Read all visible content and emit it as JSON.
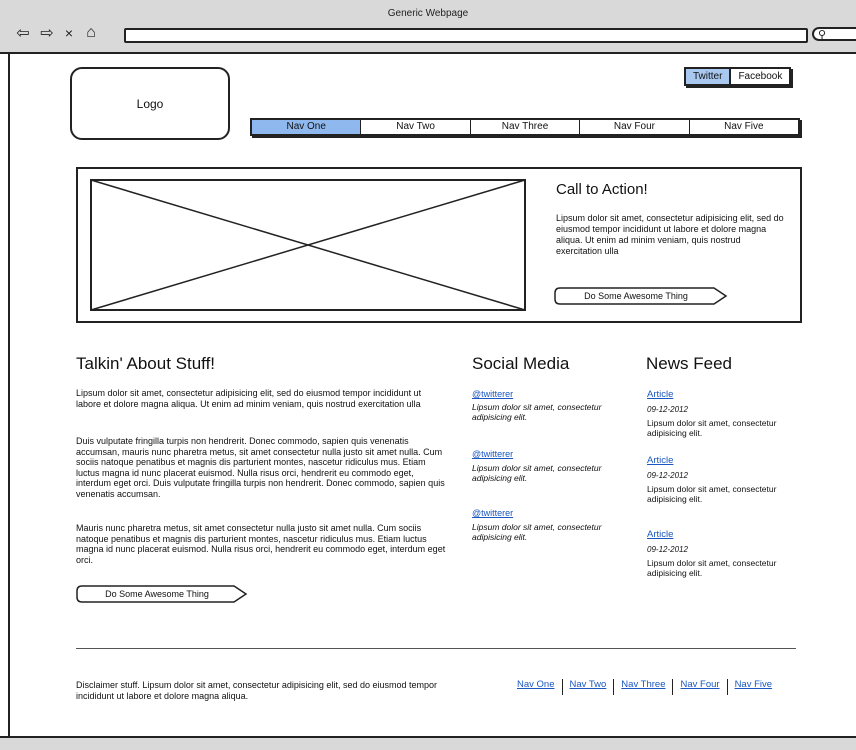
{
  "window": {
    "title": "Generic Webpage"
  },
  "header": {
    "logo_label": "Logo",
    "social_tabs": [
      "Twitter",
      "Facebook"
    ],
    "nav": [
      "Nav One",
      "Nav Two",
      "Nav Three",
      "Nav Four",
      "Nav Five"
    ]
  },
  "hero": {
    "title": "Call to Action!",
    "body": "Lipsum dolor sit amet, consectetur adipisicing elit, sed do eiusmod tempor incididunt ut labore et dolore magna aliqua. Ut enim ad minim veniam, quis nostrud exercitation ulla",
    "button": "Do Some Awesome Thing"
  },
  "talk": {
    "title": "Talkin' About Stuff!",
    "paragraphs": [
      "Lipsum dolor sit amet, consectetur adipisicing elit, sed do eiusmod tempor incididunt ut labore et dolore magna aliqua. Ut enim ad minim veniam, quis nostrud exercitation ulla",
      "Duis vulputate fringilla turpis non hendrerit. Donec commodo, sapien quis venenatis accumsan, mauris nunc pharetra metus, sit amet consectetur nulla justo sit amet nulla. Cum sociis natoque penatibus et magnis dis parturient montes, nascetur ridiculus mus. Etiam luctus magna id nunc placerat euismod. Nulla risus orci, hendrerit eu commodo eget, interdum eget orci. Duis vulputate fringilla turpis non hendrerit. Donec commodo, sapien quis venenatis accumsan.",
      "Mauris nunc pharetra metus, sit amet consectetur nulla justo sit amet nulla. Cum sociis natoque penatibus et magnis dis parturient montes, nascetur ridiculus mus. Etiam luctus magna id nunc placerat euismod. Nulla risus orci, hendrerit eu commodo eget, interdum eget orci."
    ],
    "button": "Do Some Awesome Thing"
  },
  "social": {
    "title": "Social Media",
    "posts": [
      {
        "handle": "@twitterer",
        "text": "Lipsum dolor sit amet, consectetur adipisicing elit."
      },
      {
        "handle": "@twitterer",
        "text": "Lipsum dolor sit amet, consectetur adipisicing elit."
      },
      {
        "handle": "@twitterer",
        "text": "Lipsum dolor sit amet, consectetur adipisicing elit."
      }
    ]
  },
  "news": {
    "title": "News Feed",
    "articles": [
      {
        "title": "Article",
        "date": "09-12-2012",
        "text": "Lipsum dolor sit amet, consectetur adipisicing elit."
      },
      {
        "title": "Article",
        "date": "09-12-2012",
        "text": "Lipsum dolor sit amet, consectetur adipisicing elit."
      },
      {
        "title": "Article",
        "date": "09-12-2012",
        "text": "Lipsum dolor sit amet, consectetur adipisicing elit."
      }
    ]
  },
  "footer": {
    "disclaimer": "Disclaimer stuff. Lipsum dolor sit amet, consectetur adipisicing elit, sed do eiusmod tempor incididunt ut labore et dolore magna aliqua.",
    "nav": [
      "Nav One",
      "Nav Two",
      "Nav Three",
      "Nav Four",
      "Nav Five"
    ]
  },
  "colors": {
    "active_tab": "#8fb8ee",
    "link": "#1a57c0",
    "chrome": "#d9d9d9"
  },
  "icons": [
    "back-arrow-icon",
    "forward-arrow-icon",
    "close-icon",
    "home-icon",
    "search-icon",
    "chevron-tag-icon"
  ]
}
